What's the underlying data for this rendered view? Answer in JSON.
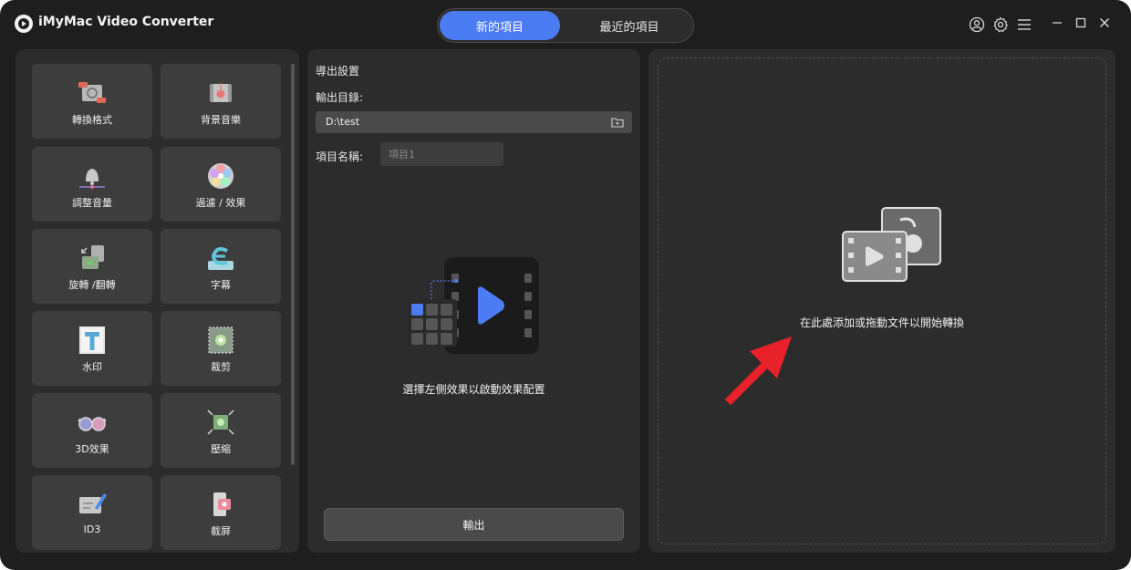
{
  "app": {
    "title": "iMyMac Video Converter"
  },
  "tabs": {
    "new_project": "新的項目",
    "recent_projects": "最近的項目"
  },
  "toolbar": {
    "icons": [
      "user-icon",
      "gear-icon",
      "menu-icon"
    ],
    "window_controls": [
      "minimize-icon",
      "maximize-icon",
      "close-icon"
    ]
  },
  "tools": [
    {
      "label": "轉換格式",
      "icon": "convert-format-icon"
    },
    {
      "label": "背景音樂",
      "icon": "background-music-icon"
    },
    {
      "label": "調整音量",
      "icon": "volume-icon"
    },
    {
      "label": "過濾 / 效果",
      "icon": "filter-effects-icon"
    },
    {
      "label": "旋轉 /翻轉",
      "icon": "rotate-flip-icon"
    },
    {
      "label": "字幕",
      "icon": "subtitle-icon"
    },
    {
      "label": "水印",
      "icon": "watermark-icon"
    },
    {
      "label": "裁剪",
      "icon": "crop-icon"
    },
    {
      "label": "3D效果",
      "icon": "3d-glasses-icon"
    },
    {
      "label": "壓縮",
      "icon": "compress-icon"
    },
    {
      "label": "ID3",
      "icon": "id3-icon"
    },
    {
      "label": "截屏",
      "icon": "screenshot-icon"
    }
  ],
  "export_settings": {
    "title": "導出設置",
    "output_dir_label": "輸出目錄:",
    "output_dir_value": "D:\\test",
    "project_name_label": "項目名稱:",
    "project_name_placeholder": "項目1",
    "hint": "選擇左側效果以啟動效果配置",
    "export_button": "輸出"
  },
  "drop_area": {
    "hint": "在此處添加或拖動文件以開始轉換"
  },
  "colors": {
    "accent": "#4b7cf3",
    "background": "#1e1e1e",
    "panel": "#2c2c2c",
    "tile": "#3d3d3d",
    "arrow": "#e8212b"
  }
}
